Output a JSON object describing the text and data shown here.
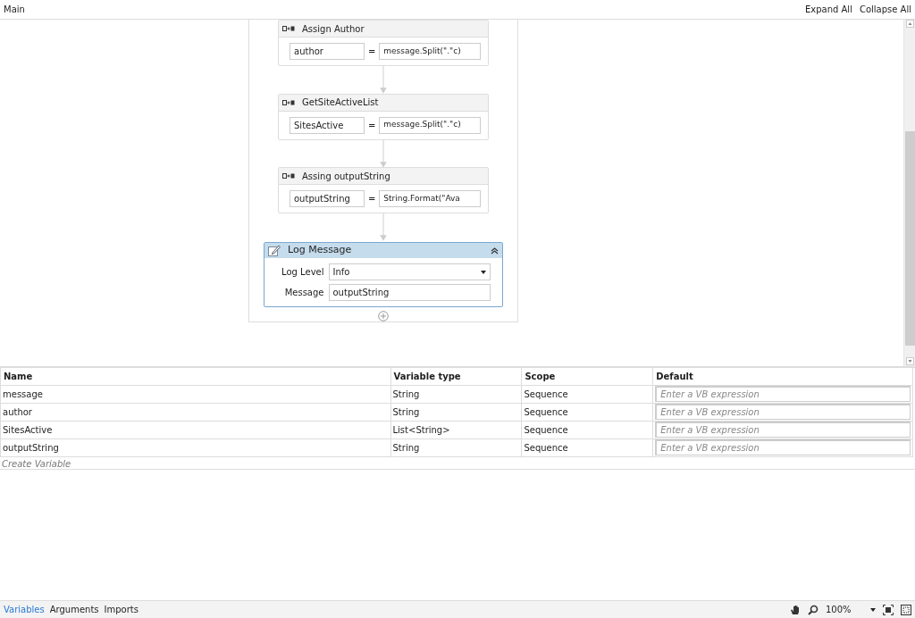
{
  "header": {
    "title": "Main",
    "actions": [
      "Expand All",
      "Collapse All"
    ]
  },
  "activities": [
    {
      "kind": "assign",
      "title": "Assign Author",
      "selected": false,
      "to": "author",
      "operator": "=",
      "value": "message.Split(\".\"c)"
    },
    {
      "kind": "assign",
      "title": "GetSiteActiveList",
      "selected": false,
      "to": "SitesActive",
      "operator": "=",
      "value": "message.Split(\".\"c)"
    },
    {
      "kind": "assign",
      "title": "Assing outputString",
      "selected": false,
      "to": "outputString",
      "operator": "=",
      "value": "String.Format(\"Ava"
    },
    {
      "kind": "log",
      "title": "Log Message",
      "selected": true,
      "fields": [
        {
          "kind": "select",
          "label": "Log Level",
          "value": "Info"
        },
        {
          "kind": "text",
          "label": "Message",
          "value": "outputString"
        }
      ]
    }
  ],
  "variables": {
    "columns": [
      "Name",
      "Variable type",
      "Scope",
      "Default"
    ],
    "rows": [
      {
        "name": "message",
        "type": "String",
        "scope": "Sequence",
        "placeholder": "Enter a VB expression"
      },
      {
        "name": "author",
        "type": "String",
        "scope": "Sequence",
        "placeholder": "Enter a VB expression"
      },
      {
        "name": "SitesActive",
        "type": "List<String>",
        "scope": "Sequence",
        "placeholder": "Enter a VB expression"
      },
      {
        "name": "outputString",
        "type": "String",
        "scope": "Sequence",
        "placeholder": "Enter a VB expression"
      }
    ],
    "create_label": "Create Variable"
  },
  "bottom_tabs": [
    {
      "label": "Variables",
      "selected": true
    },
    {
      "label": "Arguments",
      "selected": false
    },
    {
      "label": "Imports",
      "selected": false
    }
  ],
  "zoom": {
    "value": "100%"
  }
}
